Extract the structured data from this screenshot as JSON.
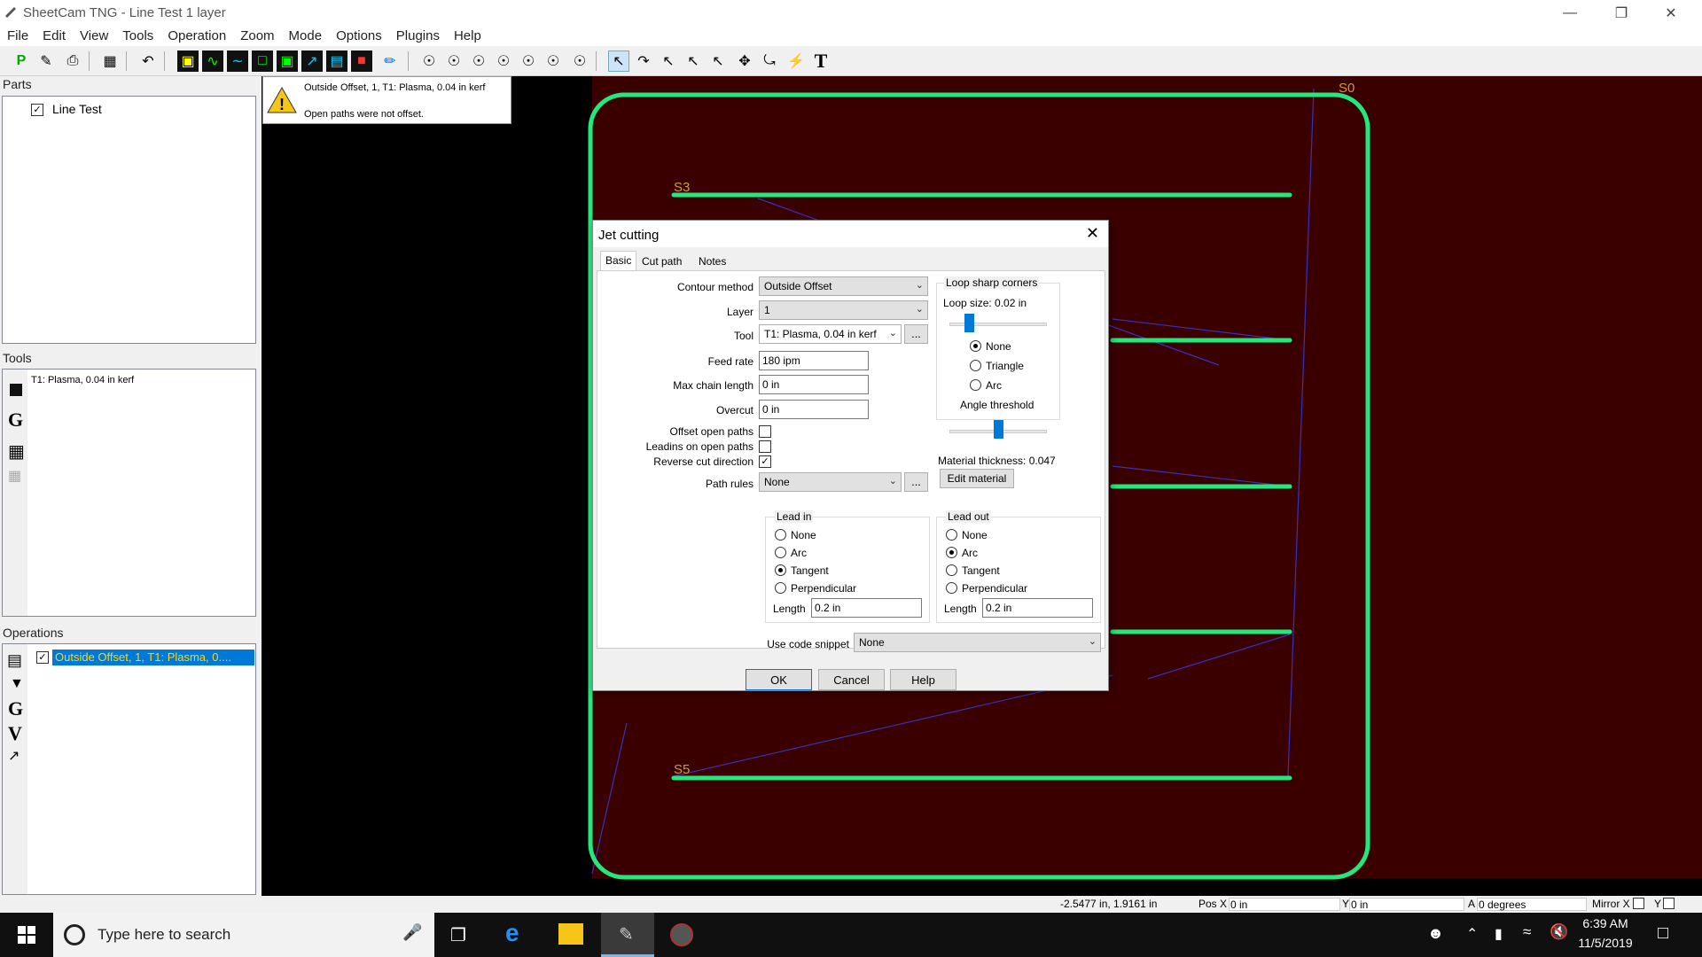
{
  "app": {
    "title": "SheetCam TNG - Line Test 1 layer"
  },
  "menu": [
    "File",
    "Edit",
    "View",
    "Tools",
    "Operation",
    "Zoom",
    "Mode",
    "Options",
    "Plugins",
    "Help"
  ],
  "parts": {
    "header": "Parts",
    "item": "Line Test"
  },
  "tools": {
    "header": "Tools",
    "item": "T1: Plasma, 0.04 in kerf"
  },
  "operations": {
    "header": "Operations",
    "item": "Outside Offset, 1, T1: Plasma, 0...."
  },
  "warning": {
    "line1": "Outside Offset, 1, T1: Plasma, 0.04 in kerf",
    "line2": "Open paths were not offset."
  },
  "canvas_labels": {
    "s3": "S3",
    "s5": "S5",
    "s0": "S0"
  },
  "dialog": {
    "title": "Jet cutting",
    "tabs": [
      "Basic",
      "Cut path",
      "Notes"
    ],
    "contour_method_label": "Contour method",
    "contour_method": "Outside Offset",
    "layer_label": "Layer",
    "layer": "1",
    "tool_label": "Tool",
    "tool": "T1: Plasma, 0.04 in kerf",
    "feed_rate_label": "Feed rate",
    "feed_rate": "180 ipm",
    "max_chain_label": "Max chain length",
    "max_chain": "0 in",
    "overcut_label": "Overcut",
    "overcut": "0 in",
    "offset_open_label": "Offset open paths",
    "offset_open": false,
    "leadins_open_label": "Leadins on open paths",
    "leadins_open": false,
    "reverse_label": "Reverse cut direction",
    "reverse": true,
    "path_rules_label": "Path rules",
    "path_rules": "None",
    "ellipsis": "...",
    "loop": {
      "title": "Loop sharp corners",
      "size_label": "Loop size: 0.02 in",
      "loop_size_fraction": 0.15,
      "options": [
        "None",
        "Triangle",
        "Arc"
      ],
      "selected": "None",
      "angle_label": "Angle threshold",
      "angle_fraction": 0.45
    },
    "material_thickness": "Material thickness: 0.047",
    "edit_material": "Edit material",
    "lead_in": {
      "title": "Lead in",
      "options": [
        "None",
        "Arc",
        "Tangent",
        "Perpendicular"
      ],
      "selected": "Tangent",
      "length_label": "Length",
      "length": "0.2 in"
    },
    "lead_out": {
      "title": "Lead out",
      "options": [
        "None",
        "Arc",
        "Tangent",
        "Perpendicular"
      ],
      "selected": "Arc",
      "length_label": "Length",
      "length": "0.2 in"
    },
    "code_snippet_label": "Use code snippet",
    "code_snippet": "None",
    "ok": "OK",
    "cancel": "Cancel",
    "help": "Help"
  },
  "status": {
    "coords": "-2.5477 in, 1.9161 in",
    "posx_label": "Pos X",
    "posx": "0 in",
    "y_label": "Y",
    "y": "0 in",
    "a_label": "A",
    "a": "0 degrees",
    "mirror_label": "Mirror X",
    "mirror_y": "Y"
  },
  "taskbar": {
    "search": "Type here to search",
    "time": "6:39 AM",
    "date": "11/5/2019"
  },
  "colors": {
    "canvas_bg": "#3a0000",
    "path": "#23e87a",
    "rapid": "#3a2fbf",
    "selection": "#0078d7",
    "label": "#c8a030"
  }
}
